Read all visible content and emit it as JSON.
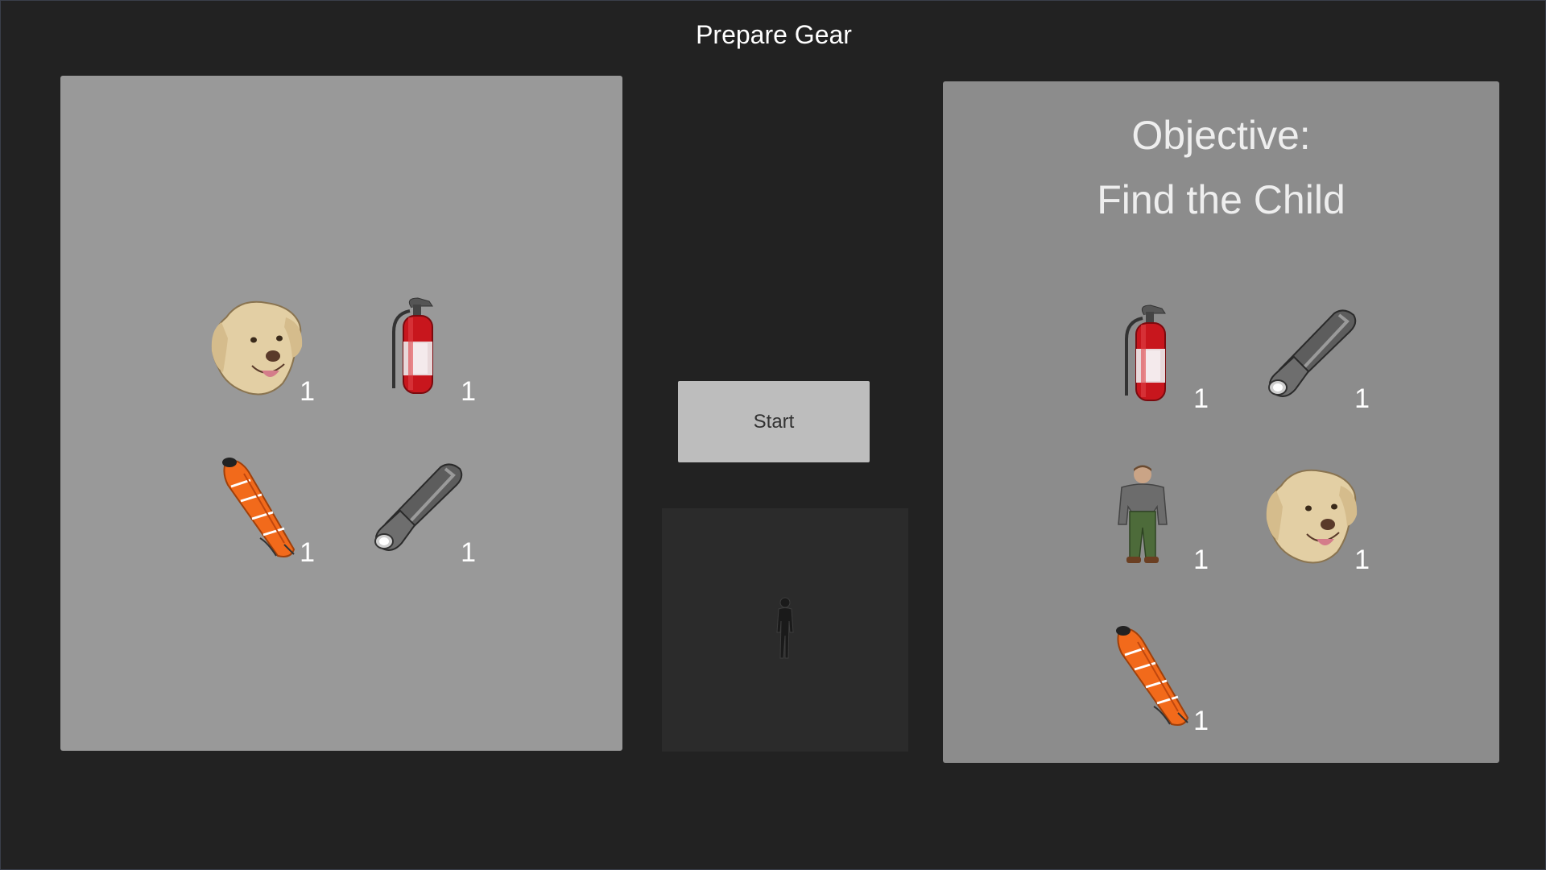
{
  "header": {
    "title": "Prepare Gear"
  },
  "inventory": {
    "items": [
      {
        "icon": "dog-head-icon",
        "count": "1"
      },
      {
        "icon": "fire-extinguisher-icon",
        "count": "1"
      },
      {
        "icon": "rescue-stretcher-icon",
        "count": "1"
      },
      {
        "icon": "flashlight-icon",
        "count": "1"
      }
    ]
  },
  "controls": {
    "start_label": "Start"
  },
  "preview": {
    "icon": "player-silhouette-icon"
  },
  "objective": {
    "heading": "Objective:",
    "goal": "Find the Child",
    "items": [
      {
        "icon": "fire-extinguisher-icon",
        "count": "1"
      },
      {
        "icon": "flashlight-icon",
        "count": "1"
      },
      {
        "icon": "person-icon",
        "count": "1"
      },
      {
        "icon": "dog-head-icon",
        "count": "1"
      },
      {
        "icon": "rescue-stretcher-icon",
        "count": "1"
      }
    ]
  },
  "colors": {
    "background": "#222222",
    "left_panel": "#999999",
    "right_panel": "#8c8c8c",
    "start_button": "#bdbdbd",
    "preview_panel": "#2b2b2b",
    "stretcher_orange": "#f26a1b",
    "extinguisher_red": "#c8161d"
  }
}
